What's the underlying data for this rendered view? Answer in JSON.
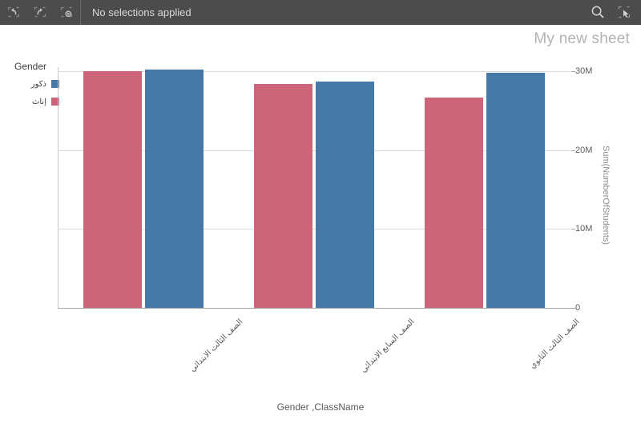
{
  "toolbar": {
    "status_text": "No selections applied",
    "buttons": [
      {
        "name": "undo-button",
        "icon": "undo-icon",
        "title": "Step back"
      },
      {
        "name": "redo-button",
        "icon": "redo-icon",
        "title": "Step forward"
      },
      {
        "name": "clear-selections-button",
        "icon": "clear-selections-icon",
        "title": "Clear all selections"
      }
    ],
    "right_buttons": [
      {
        "name": "search-button",
        "icon": "search-icon",
        "title": "Smart search"
      },
      {
        "name": "selections-tool-button",
        "icon": "selection-tool-icon",
        "title": "Selections tool"
      }
    ],
    "background_color": "#4c4c4c",
    "text_color": "#d9d9d9"
  },
  "sheet": {
    "title": "My new sheet",
    "title_color": "#b3b3b3"
  },
  "legend": {
    "title": "Gender",
    "items": [
      {
        "label": "ذكور",
        "color": "#4678a8"
      },
      {
        "label": "إناث",
        "color": "#cc6579"
      }
    ]
  },
  "chart_data": {
    "type": "bar",
    "title": "",
    "subtitle": "",
    "xlabel": "Gender ,ClassName",
    "ylabel": "Sum(NumberOfStudents)",
    "categories": [
      "الصف الثالث الابتدائي",
      "الصف السابع الابتدائي",
      "الصف الثالث الثانوي"
    ],
    "series": [
      {
        "name": "إناث",
        "color": "#cc6579",
        "values": [
          30000000,
          28400000,
          26700000
        ]
      },
      {
        "name": "ذكور",
        "color": "#4678a8",
        "values": [
          30200000,
          28700000,
          29800000
        ]
      }
    ],
    "ylim": [
      0,
      30500000
    ],
    "yticks": [
      0,
      10000000,
      20000000,
      30000000
    ],
    "ytick_labels": [
      "0",
      "10M",
      "20M",
      "30M"
    ],
    "grid": true,
    "grid_axis": "y",
    "legend_position": "top-left",
    "bar_group_mode": "grouped",
    "axis_text_color": "#595959",
    "axis_title_color": "#8c8c8c",
    "gridline_color": "#dcdcdc"
  }
}
